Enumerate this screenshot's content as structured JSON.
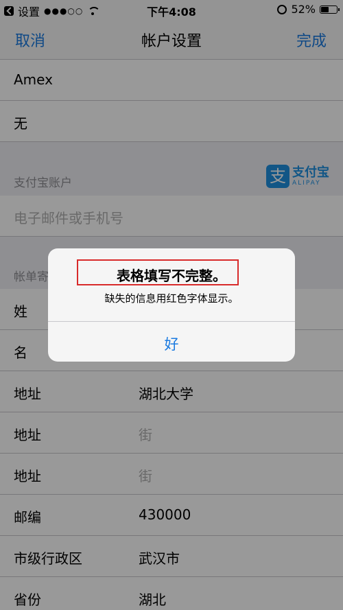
{
  "status_bar": {
    "carrier": "设置",
    "signal": "●●●○○",
    "time": "下午4:08",
    "battery": "52%",
    "battery_level": 0.52
  },
  "nav": {
    "cancel": "取消",
    "title": "帐户设置",
    "done": "完成"
  },
  "top_cells": {
    "card_type": "Amex",
    "none": "无"
  },
  "alipay": {
    "section_label": "支付宝账户",
    "logo_cn": "支付宝",
    "logo_en": "ALIPAY",
    "logo_icon": "支",
    "input_placeholder": "电子邮件或手机号"
  },
  "billing": {
    "section_label": "帐单寄",
    "rows": [
      {
        "label": "姓",
        "value": "",
        "placeholder": false
      },
      {
        "label": "名",
        "value": "",
        "placeholder": false
      },
      {
        "label": "地址",
        "value": "湖北大学",
        "placeholder": false
      },
      {
        "label": "地址",
        "value": "街",
        "placeholder": true
      },
      {
        "label": "地址",
        "value": "街",
        "placeholder": true
      },
      {
        "label": "邮编",
        "value": "430000",
        "placeholder": false
      },
      {
        "label": "市级行政区",
        "value": "武汉市",
        "placeholder": false
      },
      {
        "label": "省份",
        "value": "湖北",
        "placeholder": false
      }
    ]
  },
  "alert": {
    "title": "表格填写不完整。",
    "message": "缺失的信息用红色字体显示。",
    "ok": "好"
  }
}
